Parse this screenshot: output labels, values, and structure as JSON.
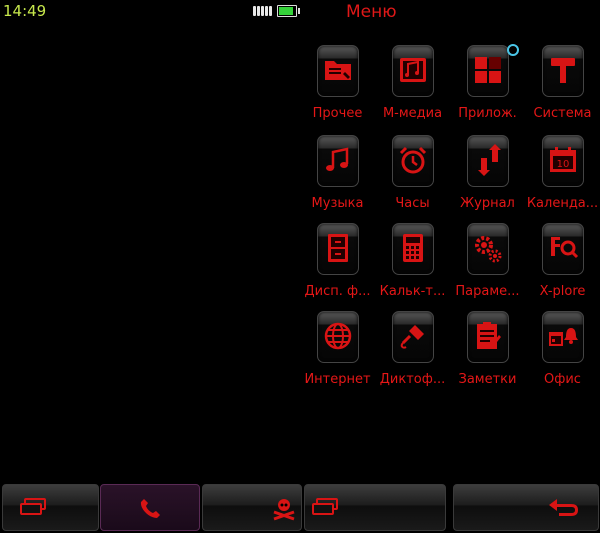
{
  "status_bar": {
    "time": "14:49",
    "title": "Меню",
    "battery_level": 0.85
  },
  "apps": [
    {
      "label": "Прочее",
      "icon": "folder-icon"
    },
    {
      "label": "М-медиа",
      "icon": "multimedia-icon"
    },
    {
      "label": "Прилож.",
      "icon": "apps-grid-icon"
    },
    {
      "label": "Система",
      "icon": "hammer-icon"
    },
    {
      "label": "Музыка",
      "icon": "music-notes-icon"
    },
    {
      "label": "Часы",
      "icon": "alarm-clock-icon"
    },
    {
      "label": "Журнал",
      "icon": "call-log-icon"
    },
    {
      "label": "Календа...",
      "icon": "calendar-icon"
    },
    {
      "label": "Дисп. ф...",
      "icon": "file-cabinet-icon"
    },
    {
      "label": "Кальк-т...",
      "icon": "calculator-icon"
    },
    {
      "label": "Параме...",
      "icon": "gears-icon"
    },
    {
      "label": "X-plore",
      "icon": "file-search-icon"
    },
    {
      "label": "Интернет",
      "icon": "globe-icon"
    },
    {
      "label": "Диктоф...",
      "icon": "microphone-icon"
    },
    {
      "label": "Заметки",
      "icon": "notepad-icon"
    },
    {
      "label": "Офис",
      "icon": "office-calendar-bell-icon"
    }
  ],
  "bottom_bar": {
    "buttons": [
      {
        "icon": "task-switcher-icon"
      },
      {
        "icon": "phone-icon",
        "active": true
      },
      {
        "icon": "skull-crossbones-icon"
      },
      {
        "icon": "task-switcher-icon"
      },
      {
        "icon": "back-arrow-icon"
      }
    ]
  },
  "colors": {
    "accent": "#e51717",
    "clock": "#c7e84c",
    "background": "#000000"
  }
}
